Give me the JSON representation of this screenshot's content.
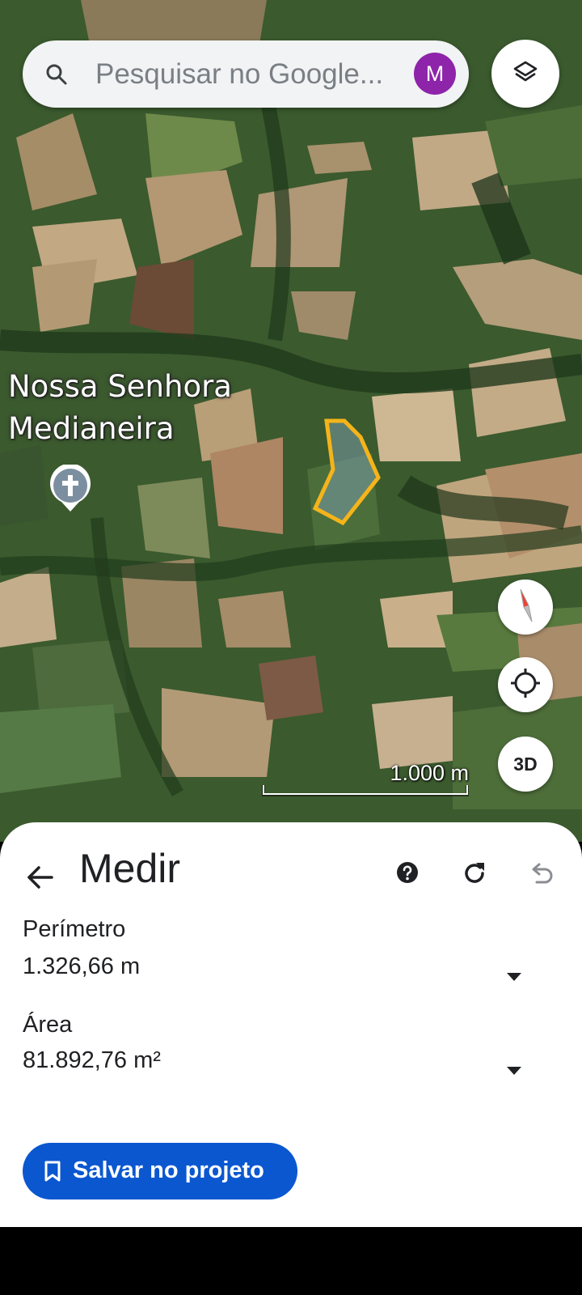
{
  "search": {
    "placeholder": "Pesquisar no Google...",
    "avatar_letter": "M"
  },
  "map": {
    "place_name": "Nossa Senhora\nMedianeira",
    "scale_label": "1.000 m",
    "button_3d_label": "3D",
    "measured_area_outline_color": "#f5b41a"
  },
  "measure_panel": {
    "title": "Medir",
    "perimeter": {
      "label": "Perímetro",
      "value": "1.326,66 m"
    },
    "area": {
      "label": "Área",
      "value": "81.892,76 m²"
    },
    "save_button_label": "Salvar no projeto"
  },
  "colors": {
    "accent_blue": "#0b57d0",
    "avatar_purple": "#8e24aa"
  }
}
